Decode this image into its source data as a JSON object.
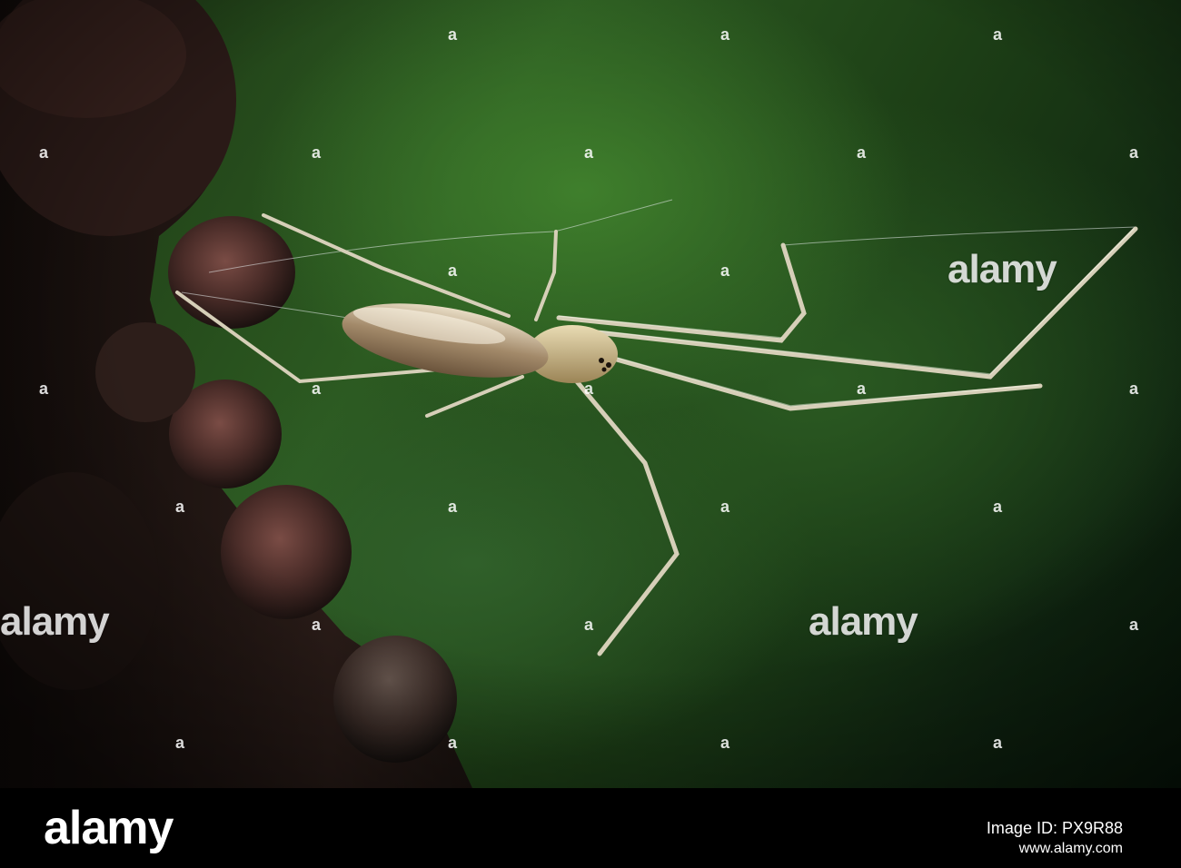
{
  "image": {
    "subject": "spider",
    "background_color": "#1f4a1a"
  },
  "watermark": {
    "text": "alamy",
    "color": "#ffffff"
  },
  "footer": {
    "logo": "alamy",
    "image_id": "Image ID: PX9R88",
    "url": "www.alamy.com"
  }
}
